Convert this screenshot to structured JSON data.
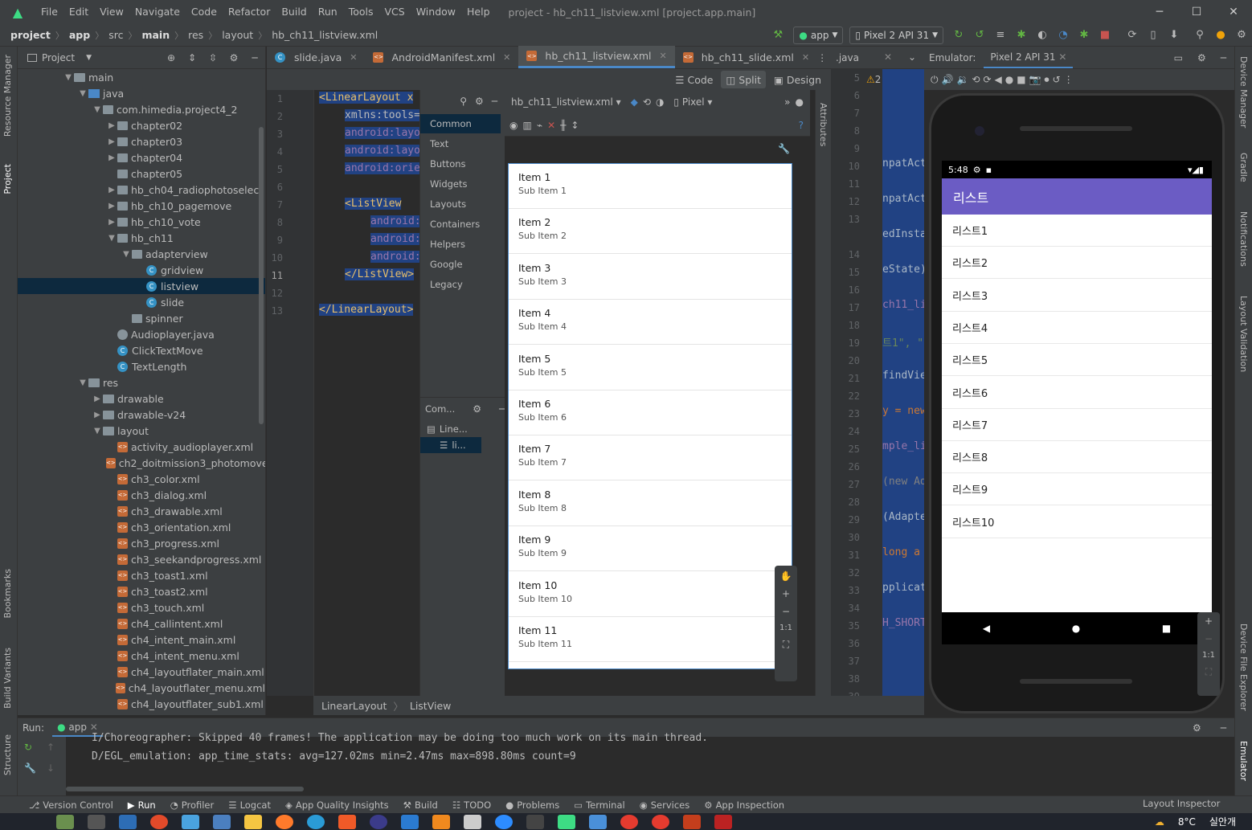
{
  "window": {
    "title": "project - hb_ch11_listview.xml [project.app.main]",
    "menu": [
      "File",
      "Edit",
      "View",
      "Navigate",
      "Code",
      "Refactor",
      "Build",
      "Run",
      "Tools",
      "VCS",
      "Window",
      "Help"
    ]
  },
  "navbar": {
    "crumbs": [
      "project",
      "app",
      "src",
      "main",
      "res",
      "layout",
      "hb_ch11_listview.xml"
    ],
    "run_config": "app",
    "device": "Pixel 2 API 31"
  },
  "project_panel": {
    "title": "Project",
    "tree": [
      {
        "label": "main",
        "depth": 0,
        "kind": "folder",
        "open": true
      },
      {
        "label": "java",
        "depth": 1,
        "kind": "folder-blue",
        "open": true
      },
      {
        "label": "com.himedia.project4_2",
        "depth": 2,
        "kind": "package",
        "open": true
      },
      {
        "label": "chapter02",
        "depth": 3,
        "kind": "package",
        "open": false
      },
      {
        "label": "chapter03",
        "depth": 3,
        "kind": "package",
        "open": false
      },
      {
        "label": "chapter04",
        "depth": 3,
        "kind": "package",
        "open": false
      },
      {
        "label": "chapter05",
        "depth": 3,
        "kind": "package",
        "open": null
      },
      {
        "label": "hb_ch04_radiophotoselect",
        "depth": 3,
        "kind": "package",
        "open": false
      },
      {
        "label": "hb_ch10_pagemove",
        "depth": 3,
        "kind": "package",
        "open": false
      },
      {
        "label": "hb_ch10_vote",
        "depth": 3,
        "kind": "package",
        "open": false
      },
      {
        "label": "hb_ch11",
        "depth": 3,
        "kind": "package",
        "open": true
      },
      {
        "label": "adapterview",
        "depth": 4,
        "kind": "package",
        "open": true
      },
      {
        "label": "gridview",
        "depth": 5,
        "kind": "class",
        "open": null
      },
      {
        "label": "listview",
        "depth": 5,
        "kind": "class",
        "open": null,
        "selected": true
      },
      {
        "label": "slide",
        "depth": 5,
        "kind": "class",
        "open": null
      },
      {
        "label": "spinner",
        "depth": 4,
        "kind": "package",
        "open": null
      },
      {
        "label": "Audioplayer.java",
        "depth": 3,
        "kind": "java",
        "open": null
      },
      {
        "label": "ClickTextMove",
        "depth": 3,
        "kind": "class",
        "open": null
      },
      {
        "label": "TextLength",
        "depth": 3,
        "kind": "class",
        "open": null
      },
      {
        "label": "res",
        "depth": 1,
        "kind": "folder",
        "open": true
      },
      {
        "label": "drawable",
        "depth": 2,
        "kind": "folder",
        "open": false
      },
      {
        "label": "drawable-v24",
        "depth": 2,
        "kind": "folder",
        "open": false
      },
      {
        "label": "layout",
        "depth": 2,
        "kind": "folder",
        "open": true
      },
      {
        "label": "activity_audioplayer.xml",
        "depth": 3,
        "kind": "xml",
        "open": null
      },
      {
        "label": "ch2_doitmission3_photomove",
        "depth": 3,
        "kind": "xml",
        "open": null
      },
      {
        "label": "ch3_color.xml",
        "depth": 3,
        "kind": "xml",
        "open": null
      },
      {
        "label": "ch3_dialog.xml",
        "depth": 3,
        "kind": "xml",
        "open": null
      },
      {
        "label": "ch3_drawable.xml",
        "depth": 3,
        "kind": "xml",
        "open": null
      },
      {
        "label": "ch3_orientation.xml",
        "depth": 3,
        "kind": "xml",
        "open": null
      },
      {
        "label": "ch3_progress.xml",
        "depth": 3,
        "kind": "xml",
        "open": null
      },
      {
        "label": "ch3_seekandprogress.xml",
        "depth": 3,
        "kind": "xml",
        "open": null
      },
      {
        "label": "ch3_toast1.xml",
        "depth": 3,
        "kind": "xml",
        "open": null
      },
      {
        "label": "ch3_toast2.xml",
        "depth": 3,
        "kind": "xml",
        "open": null
      },
      {
        "label": "ch3_touch.xml",
        "depth": 3,
        "kind": "xml",
        "open": null
      },
      {
        "label": "ch4_callintent.xml",
        "depth": 3,
        "kind": "xml",
        "open": null
      },
      {
        "label": "ch4_intent_main.xml",
        "depth": 3,
        "kind": "xml",
        "open": null
      },
      {
        "label": "ch4_intent_menu.xml",
        "depth": 3,
        "kind": "xml",
        "open": null
      },
      {
        "label": "ch4_layoutflater_main.xml",
        "depth": 3,
        "kind": "xml",
        "open": null
      },
      {
        "label": "ch4_layoutflater_menu.xml",
        "depth": 3,
        "kind": "xml",
        "open": null
      },
      {
        "label": "ch4_layoutflater_sub1.xml",
        "depth": 3,
        "kind": "xml",
        "open": null
      }
    ]
  },
  "left_stripe": [
    "Resource Manager",
    "Project",
    "Bookmarks",
    "Build Variants",
    "Structure"
  ],
  "right_stripe": [
    "Device Manager",
    "Gradle",
    "Notifications",
    "Layout Validation",
    "Device File Explorer",
    "Emulator"
  ],
  "editor_tabs": [
    {
      "label": "slide.java",
      "active": false
    },
    {
      "label": "AndroidManifest.xml",
      "active": false
    },
    {
      "label": "hb_ch11_listview.xml",
      "active": true
    },
    {
      "label": "hb_ch11_slide.xml",
      "active": false
    }
  ],
  "view_modes": {
    "code": "Code",
    "split": "Split",
    "design": "Design"
  },
  "code": {
    "line_numbers": [
      "1",
      "2",
      "3",
      "4",
      "5",
      "6",
      "7",
      "8",
      "9",
      "10",
      "11",
      "12",
      "13"
    ],
    "lines": [
      {
        "t": "<LinearLayout x",
        "cls": "tag",
        "indent": 0
      },
      {
        "t": "xmlns:tools=",
        "cls": "ns",
        "indent": 1
      },
      {
        "t": "android:layo",
        "cls": "attr",
        "indent": 1
      },
      {
        "t": "android:layo",
        "cls": "attr",
        "indent": 1
      },
      {
        "t": "android:orie",
        "cls": "attr",
        "indent": 1
      },
      {
        "t": "",
        "cls": "ns",
        "indent": 0
      },
      {
        "t": "<ListView",
        "cls": "tag",
        "indent": 1
      },
      {
        "t": "android:",
        "cls": "attr",
        "indent": 2
      },
      {
        "t": "android:",
        "cls": "attr",
        "indent": 2
      },
      {
        "t": "android:",
        "cls": "attr",
        "indent": 2
      },
      {
        "t": "</ListView>",
        "cls": "tag",
        "indent": 1
      },
      {
        "t": "",
        "cls": "ns",
        "indent": 0
      },
      {
        "t": "</LinearLayout>",
        "cls": "tag",
        "indent": 0
      }
    ]
  },
  "palette": {
    "categories": [
      "Common",
      "Text",
      "Buttons",
      "Widgets",
      "Layouts",
      "Containers",
      "Helpers",
      "Google",
      "Legacy"
    ],
    "tree_header": "Com...",
    "tree_items": [
      "Line...",
      "li..."
    ]
  },
  "design": {
    "file": "hb_ch11_listview.xml",
    "device": "Pixel",
    "items": [
      {
        "title": "Item 1",
        "sub": "Sub Item 1"
      },
      {
        "title": "Item 2",
        "sub": "Sub Item 2"
      },
      {
        "title": "Item 3",
        "sub": "Sub Item 3"
      },
      {
        "title": "Item 4",
        "sub": "Sub Item 4"
      },
      {
        "title": "Item 5",
        "sub": "Sub Item 5"
      },
      {
        "title": "Item 6",
        "sub": "Sub Item 6"
      },
      {
        "title": "Item 7",
        "sub": "Sub Item 7"
      },
      {
        "title": "Item 8",
        "sub": "Sub Item 8"
      },
      {
        "title": "Item 9",
        "sub": "Sub Item 9"
      },
      {
        "title": "Item 10",
        "sub": "Sub Item 10"
      },
      {
        "title": "Item 11",
        "sub": "Sub Item 11"
      }
    ],
    "zoom_labels": {
      "fit": "1:1"
    }
  },
  "attributes_label": "Attributes",
  "java_editor": {
    "tab": ".java",
    "warning_count": "2",
    "line_numbers": [
      "5",
      "6",
      "7",
      "8",
      "9",
      "10",
      "11",
      "12",
      "13",
      "",
      "14",
      "15",
      "16",
      "17",
      "18",
      "19",
      "20",
      "21",
      "22",
      "23",
      "24",
      "25",
      "26",
      "27",
      "28",
      "29",
      "30",
      "31",
      "32",
      "33",
      "34",
      "35",
      "36",
      "37",
      "38",
      "39"
    ],
    "snippets": [
      {
        "line": 5,
        "text": "npatAct",
        "color": "#a9b7c6"
      },
      {
        "line": 10,
        "text": "npatAct",
        "color": "#a9b7c6"
      },
      {
        "line": 13,
        "text": "edInsta",
        "color": "#a9b7c6"
      },
      {
        "line": 14,
        "text": "eState)",
        "color": "#a9b7c6"
      },
      {
        "line": 15,
        "text": "ch11_li",
        "color": "#9876aa"
      },
      {
        "line": 18,
        "text": "트1\", \"",
        "color": "#6a8759"
      },
      {
        "line": 20,
        "text": "findVie",
        "color": "#a9b7c6"
      },
      {
        "line": 22,
        "text": "y = new",
        "color": "#cc7832"
      },
      {
        "line": 23,
        "text": "mple_li",
        "color": "#9876aa"
      },
      {
        "line": 26,
        "text": "(new Ad",
        "color": "#808080"
      },
      {
        "line": 27,
        "text": "(Adapte",
        "color": "#a9b7c6"
      },
      {
        "line": 28,
        "text": "long a",
        "color": "#cc7832"
      },
      {
        "line": 29,
        "text": "pplicat",
        "color": "#a9b7c6"
      },
      {
        "line": 30,
        "text": "H_SHORT",
        "color": "#9876aa"
      }
    ]
  },
  "emulator": {
    "label": "Emulator:",
    "device_tab": "Pixel 2 API 31",
    "status_time": "5:48",
    "app_title": "리스트",
    "rows": [
      "리스트1",
      "리스트2",
      "리스트3",
      "리스트4",
      "리스트5",
      "리스트6",
      "리스트7",
      "리스트8",
      "리스트9",
      "리스트10"
    ],
    "zoom_fit": "1:1"
  },
  "breadcrumb_bottom": [
    "LinearLayout",
    "ListView"
  ],
  "run_panel": {
    "label": "Run:",
    "config": "app",
    "logs": [
      "I/Choreographer: Skipped 40 frames!  The application may be doing too much work on its main thread.",
      "D/EGL_emulation: app_time_stats: avg=127.02ms min=2.47ms max=898.80ms count=9"
    ]
  },
  "bottom_tools": [
    "Version Control",
    "Run",
    "Profiler",
    "Logcat",
    "App Quality Insights",
    "Build",
    "TODO",
    "Problems",
    "Terminal",
    "Services",
    "App Inspection"
  ],
  "bottom_right_tool": "Layout Inspector",
  "taskbar": {
    "weather": "8°C",
    "weather_text": "실안개"
  },
  "colors": {
    "accent": "#4a88c7",
    "app_bar": "#6b5cc4",
    "android_green": "#3ddc84",
    "selection": "#214283"
  }
}
